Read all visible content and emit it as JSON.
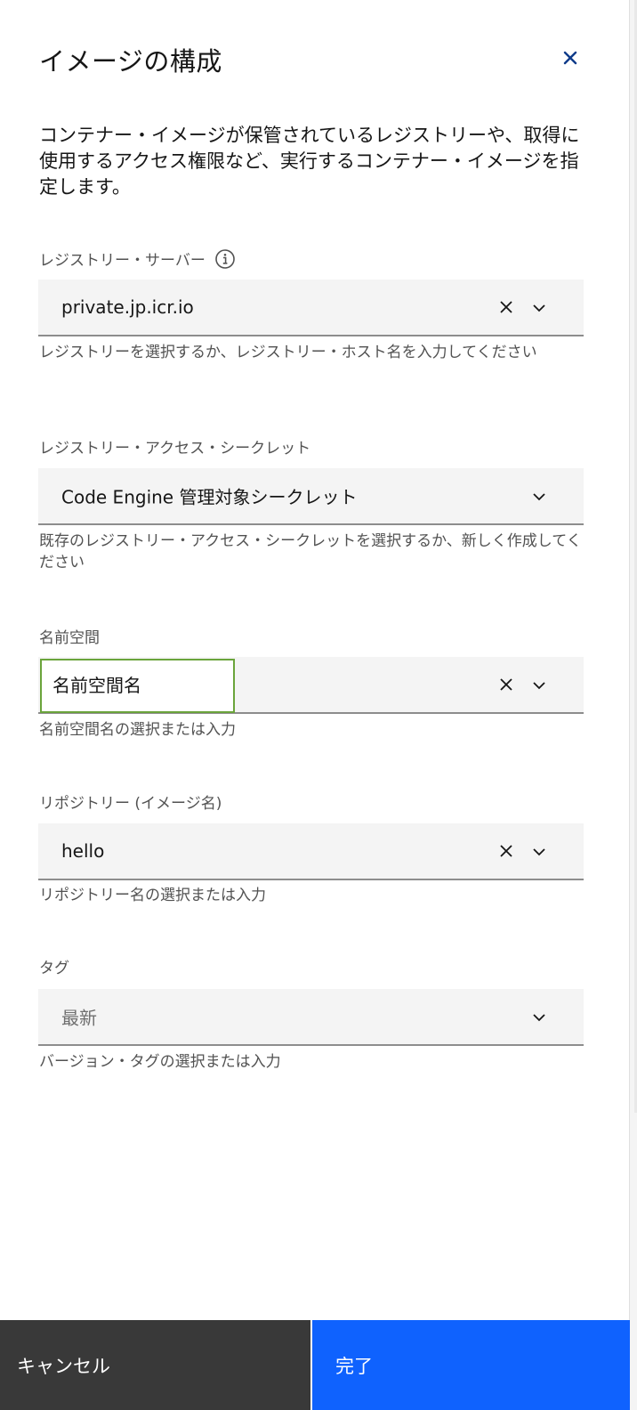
{
  "dialog": {
    "title": "イメージの構成",
    "description": "コンテナー・イメージが保管されているレジストリーや、取得に使用するアクセス権限など、実行するコンテナー・イメージを指定します。"
  },
  "registry_server": {
    "label": "レジストリー・サーバー",
    "value": "private.jp.icr.io",
    "helper": "レジストリーを選択するか、レジストリー・ホスト名を入力してください"
  },
  "registry_secret": {
    "label": "レジストリー・アクセス・シークレット",
    "value": "Code Engine 管理対象シークレット",
    "helper": "既存のレジストリー・アクセス・シークレットを選択するか、新しく作成してください"
  },
  "namespace": {
    "label": "名前空間",
    "value": "名前空間名",
    "helper": "名前空間名の選択または入力"
  },
  "repository": {
    "label": "リポジトリー (イメージ名)",
    "value": "hello",
    "helper": "リポジトリー名の選択または入力"
  },
  "tag": {
    "label": "タグ",
    "placeholder": "最新",
    "helper": "バージョン・タグの選択または入力"
  },
  "footer": {
    "cancel_label": "キャンセル",
    "done_label": "完了"
  },
  "colors": {
    "primary": "#0f62fe",
    "secondary": "#393939",
    "focus_highlight": "#6aa43b"
  }
}
